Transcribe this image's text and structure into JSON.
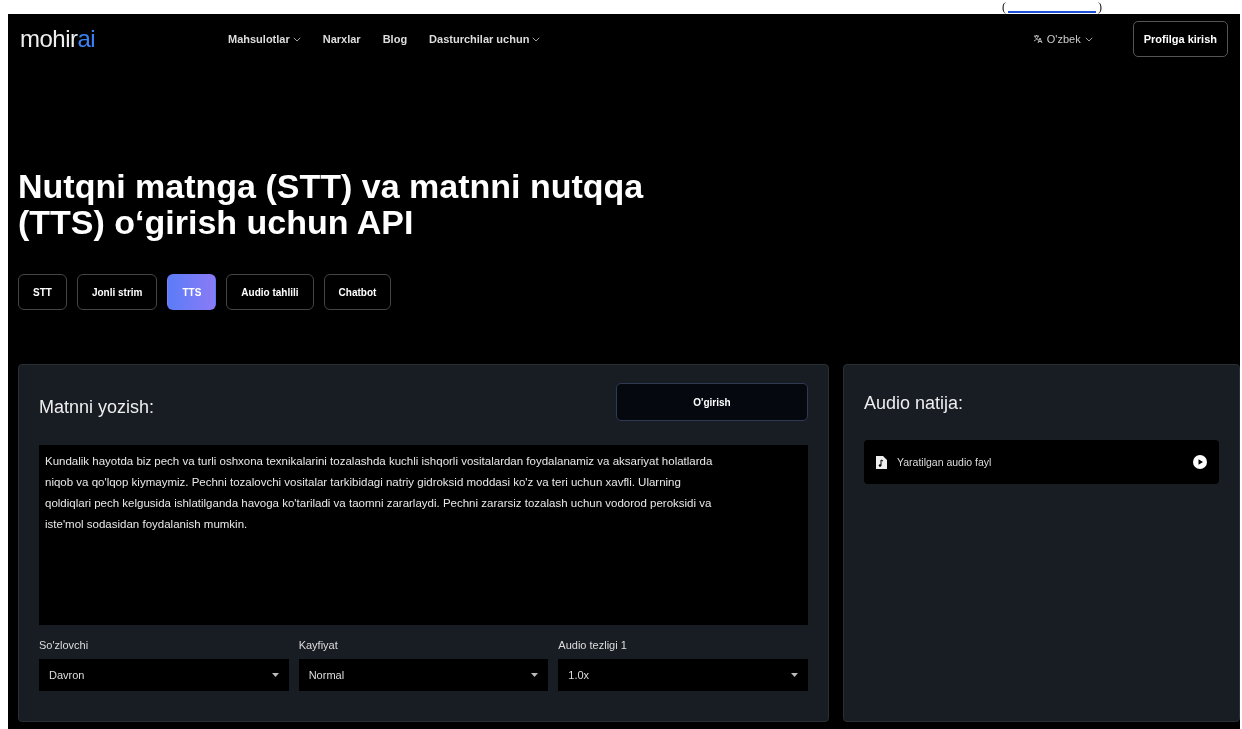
{
  "top_strip": {
    "open": "(",
    "close": ")"
  },
  "header": {
    "logo": {
      "main": "mohir",
      "accent": "ai"
    },
    "nav": [
      {
        "label": "Mahsulotlar",
        "dropdown": true
      },
      {
        "label": "Narxlar",
        "dropdown": false
      },
      {
        "label": "Blog",
        "dropdown": false
      },
      {
        "label": "Dasturchilar uchun",
        "dropdown": true
      }
    ],
    "language": "O'zbek",
    "login_button": "Profilga kirish"
  },
  "title": "Nutqni matnga (STT) va matnni nutqqa (TTS) o‘girish uchun API",
  "tabs": [
    {
      "label": "STT",
      "selected": false
    },
    {
      "label": "Jonli strim",
      "selected": false
    },
    {
      "label": "TTS",
      "selected": true
    },
    {
      "label": "Audio tahlili",
      "selected": false
    },
    {
      "label": "Chatbot",
      "selected": false
    }
  ],
  "input_panel": {
    "heading": "Matnni yozish:",
    "convert_button": "O'girish",
    "text": "Kundalik hayotda biz pech va turli oshxona texnikalarini tozalashda kuchli ishqorli vositalardan foydalanamiz va aksariyat holatlarda niqob va qo'lqop kiymaymiz. Pechni tozalovchi vositalar tarkibidagi natriy gidroksid moddasi ko'z va teri uchun xavfli. Ularning qoldiqlari pech kelgusida ishlatilganda havoga ko'tariladi va taomni zararlaydi. Pechni zararsiz tozalash uchun vodorod peroksidi va iste'mol sodasidan foydalanish mumkin.",
    "selects": [
      {
        "label": "So'zlovchi",
        "value": "Davron"
      },
      {
        "label": "Kayfiyat",
        "value": "Normal"
      },
      {
        "label": "Audio tezligi 1",
        "value": "1.0x"
      }
    ]
  },
  "result_panel": {
    "heading": "Audio natija:",
    "file_label": "Yaratilgan audio fayl"
  }
}
